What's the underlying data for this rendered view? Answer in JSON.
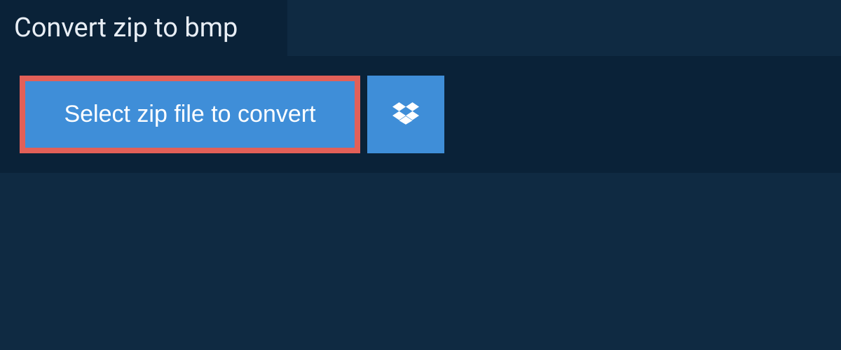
{
  "header": {
    "title": "Convert zip to bmp"
  },
  "actions": {
    "select_file_label": "Select zip file to convert"
  },
  "colors": {
    "accent": "#3f8ed8",
    "highlight_border": "#e26058",
    "bg_dark": "#0a2238",
    "bg": "#0f2a42"
  }
}
